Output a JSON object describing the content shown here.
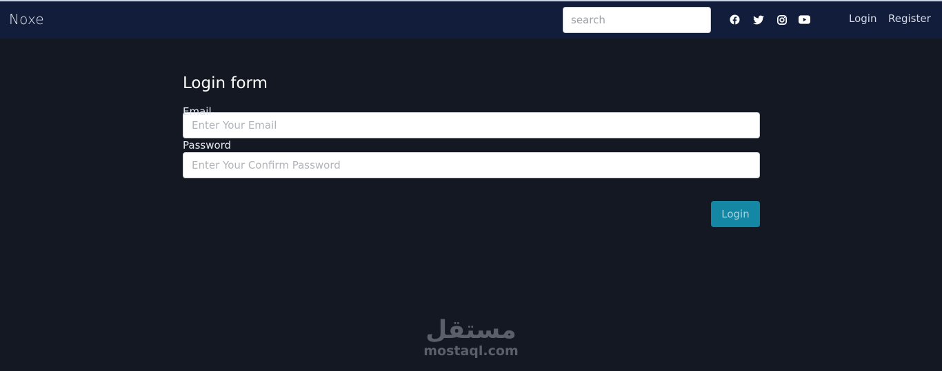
{
  "navbar": {
    "brand": "Noxe",
    "search_placeholder": "search",
    "social_icons": [
      "facebook-icon",
      "twitter-icon",
      "instagram-icon",
      "youtube-icon"
    ],
    "login_label": "Login",
    "register_label": "Register"
  },
  "form": {
    "title": "Login form",
    "email_label": "Email",
    "email_placeholder": "Enter Your Email",
    "password_label": "Password",
    "password_placeholder": "Enter Your Confirm Password",
    "submit_label": "Login"
  },
  "watermark": {
    "arabic": "مستقل",
    "latin": "mostaql.com"
  },
  "colors": {
    "background": "#141823",
    "navbar": "#121d3c",
    "accent": "#1387a3"
  }
}
